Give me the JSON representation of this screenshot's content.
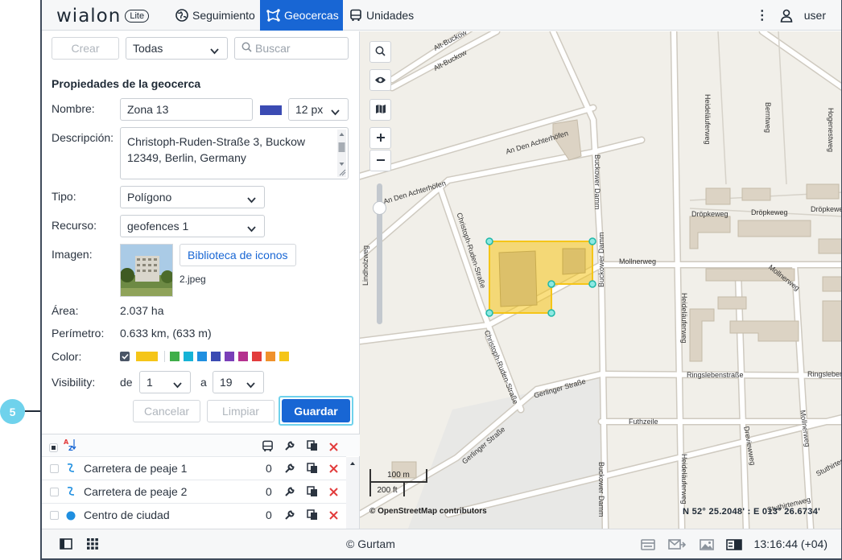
{
  "app": {
    "logo": "wialon",
    "logo_badge": "Lite"
  },
  "header": {
    "tabs": [
      {
        "label": "Seguimiento",
        "icon": "globe-icon"
      },
      {
        "label": "Geocercas",
        "icon": "geofence-icon",
        "active": true
      },
      {
        "label": "Unidades",
        "icon": "bus-icon"
      }
    ],
    "user": "user"
  },
  "toolbar": {
    "create_label": "Crear",
    "filter_value": "Todas",
    "search_placeholder": "Buscar"
  },
  "form": {
    "title": "Propiedades de la geocerca",
    "name_label": "Nombre:",
    "name_value": "Zona 13",
    "line_width": "12 px",
    "description_label": "Descripción:",
    "description_line1": "Christoph-Ruden-Straße 3, Buckow",
    "description_line2": "12349, Berlin, Germany",
    "type_label": "Tipo:",
    "type_value": "Polígono",
    "resource_label": "Recurso:",
    "resource_value": "geofences 1",
    "image_label": "Imagen:",
    "icon_library": "Biblioteca de iconos",
    "image_file": "2.jpeg",
    "area_label": "Área:",
    "area_value": "2.037 ha",
    "perimeter_label": "Perímetro:",
    "perimeter_value": "0.633 km, (633 m)",
    "color_label": "Color:",
    "visibility_label": "Visibility:",
    "vis_from_label": "de",
    "vis_from": "1",
    "vis_to_label": "a",
    "vis_to": "19",
    "cancel_label": "Cancelar",
    "clear_label": "Limpiar",
    "save_label": "Guardar"
  },
  "colors": {
    "accent": "#1866d4",
    "geofence_fill": "#f5c518",
    "palette": [
      "#f5c518",
      "#3fae49",
      "#17b3d6",
      "#1f8fe0",
      "#3b4bb3",
      "#7a3fb8",
      "#b5318f",
      "#e23c3c",
      "#f0912b",
      "#f5c518"
    ]
  },
  "list": {
    "items": [
      {
        "name": "Carretera de peaje 1",
        "count": "0",
        "icon": "route-icon"
      },
      {
        "name": "Carretera de peaje 2",
        "count": "0",
        "icon": "route-icon"
      },
      {
        "name": "Centro de ciudad",
        "count": "0",
        "icon": "circle-icon"
      }
    ]
  },
  "map": {
    "streets": [
      "Alt-Buckow",
      "Alt-Buckow",
      "An Den Achterhöfen",
      "An Den Achterhöfen",
      "Lindholzweg",
      "Christoph-Ruden-Straße",
      "Christoph-Ruden-Straße",
      "Buckower Damm",
      "Buckower Damm",
      "Buckower Damm",
      "Heideläuferweg",
      "Berntweg",
      "Hogenestweg",
      "Dröpkeweg",
      "Dröpkeweg",
      "Dröpkeweg",
      "Mollnerweg",
      "Mollnerweg",
      "Heideläuferweg",
      "Ringslebenstraße",
      "Ringsleben",
      "Gerlinger Straße",
      "Gerlinger Straße",
      "Futhzeile",
      "Dreviewweg",
      "Mollnerweg",
      "Heideläuferweg",
      "Stuthirtenweg",
      "Stuthirtenweg"
    ],
    "scale_top": "100 m",
    "scale_bottom": "200 ft",
    "attribution": "© OpenStreetMap contributors",
    "coordinates": "N 52° 25.2048' : E 013° 26.6734'"
  },
  "footer": {
    "copyright": "© Gurtam",
    "clock": "13:16:44 (+04)"
  },
  "callout": {
    "number": "5"
  }
}
